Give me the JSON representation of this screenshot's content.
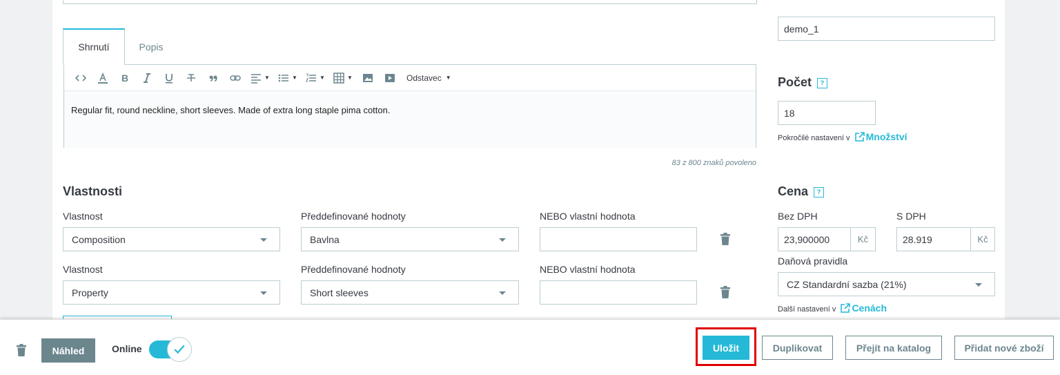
{
  "editor": {
    "tabs": [
      {
        "label": "Shrnutí",
        "active": true
      },
      {
        "label": "Popis",
        "active": false
      }
    ],
    "format_label": "Odstavec",
    "content": "Regular fit, round neckline, short sleeves. Made of extra long staple pima cotton.",
    "char_counter": "83 z 800 znaků povoleno"
  },
  "features": {
    "title": "Vlastnosti",
    "rows": [
      {
        "feature_label": "Vlastnost",
        "feature_value": "Composition",
        "predefined_label": "Předdefinované hodnoty",
        "predefined_value": "Bavlna",
        "custom_label": "NEBO vlastní hodnota",
        "custom_value": ""
      },
      {
        "feature_label": "Vlastnost",
        "feature_value": "Property",
        "predefined_label": "Předdefinované hodnoty",
        "predefined_value": "Short sleeves",
        "custom_label": "NEBO vlastní hodnota",
        "custom_value": ""
      }
    ]
  },
  "sidebar": {
    "reference_value": "demo_1",
    "quantity": {
      "title": "Počet",
      "help": "?",
      "value": "18",
      "advanced_prefix": "Pokročilé nastavení v",
      "advanced_link": "Množství"
    },
    "price": {
      "title": "Cena",
      "help": "?",
      "tax_excl_label": "Bez DPH",
      "tax_excl_value": "23,900000",
      "tax_incl_label": "S DPH",
      "tax_incl_value": "28.919",
      "currency": "Kč",
      "tax_rule_label": "Daňová pravidla",
      "tax_rule_value": "CZ Standardní sazba (21%)",
      "more_prefix": "Další nastavení v",
      "more_link": "Cenách"
    }
  },
  "footer": {
    "preview_label": "Náhled",
    "online_label": "Online",
    "online_enabled": true,
    "save_label": "Uložit",
    "duplicate_label": "Duplikovat",
    "goto_catalog_label": "Přejít na katalog",
    "add_new_label": "Přidat nové zboží"
  },
  "colors": {
    "accent": "#25b9d7",
    "muted": "#6c868e",
    "highlight_border": "#e00000"
  }
}
